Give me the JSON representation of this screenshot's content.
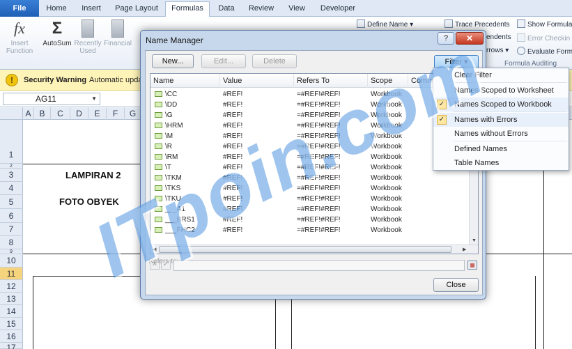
{
  "tabs": [
    "File",
    "Home",
    "Insert",
    "Page Layout",
    "Formulas",
    "Data",
    "Review",
    "View",
    "Developer"
  ],
  "ribbon": {
    "insert_function": "Insert Function",
    "autosum": "AutoSum",
    "recently_used": "Recently Used",
    "financial": "Financial",
    "define_name": "Define Name",
    "trace_precedents": "Trace Precedents",
    "trace_dependents": "endents",
    "remove_arrows": "rrows",
    "show_formulas": "Show Formula",
    "error_checking": "Error Checkin",
    "evaluate_formula": "Evaluate Form",
    "formula_auditing": "Formula Auditing"
  },
  "security": {
    "title": "Security Warning",
    "text": "Automatic upda"
  },
  "namebox": {
    "value": "AG11"
  },
  "columns": [
    "A",
    "B",
    "C",
    "D",
    "E",
    "F",
    "G"
  ],
  "rows": [
    "1",
    "2",
    "3",
    "4",
    "5",
    "6",
    "7",
    "8",
    "9",
    "10",
    "11",
    "12",
    "13",
    "14",
    "15",
    "16",
    "17"
  ],
  "sheet": {
    "lampiran": "LAMPIRAN 2",
    "foto": "FOTO OBYEK"
  },
  "dialog": {
    "title": "Name Manager",
    "help": "?",
    "close": "✕",
    "new_btn": "New...",
    "edit_btn": "Edit...",
    "delete_btn": "Delete",
    "filter_btn": "Filter ▾",
    "headers": [
      "Name",
      "Value",
      "Refers To",
      "Scope",
      "Comme"
    ],
    "rows": [
      [
        "\\CC",
        "#REF!",
        "=#REF!#REF!",
        "Workbook"
      ],
      [
        "\\DD",
        "#REF!",
        "=#REF!#REF!",
        "Workbook"
      ],
      [
        "\\G",
        "#REF!",
        "=#REF!#REF!",
        "Workbook"
      ],
      [
        "\\HRM",
        "#REF!",
        "=#REF!#REF!",
        "Workbook"
      ],
      [
        "\\M",
        "#REF!",
        "=#REF!#REF!",
        "Workbook"
      ],
      [
        "\\R",
        "#REF!",
        "=#REF!#REF!",
        "Workbook"
      ],
      [
        "\\RM",
        "#REF!",
        "=#REF!#REF!",
        "Workbook"
      ],
      [
        "\\T",
        "#REF!",
        "=#REF!#REF!",
        "Workbook"
      ],
      [
        "\\TKM",
        "#REF!",
        "=#REF!#REF!",
        "Workbook"
      ],
      [
        "\\TKS",
        "#REF!",
        "=#REF!#REF!",
        "Workbook"
      ],
      [
        "\\TKU",
        "#REF!",
        "=#REF!#REF!",
        "Workbook"
      ],
      [
        "___A1",
        "#REF!",
        "=#REF!#REF!",
        "Workbook"
      ],
      [
        "___BRS1",
        "#REF!",
        "=#REF!#REF!",
        "Workbook"
      ],
      [
        "___FHC2",
        "#REF!",
        "=#REF!#REF!",
        "Workbook"
      ]
    ],
    "refers_label": "Refers to:",
    "close_btn": "Close"
  },
  "filter_menu": {
    "items": [
      {
        "label": "Clear Filter",
        "checked": false
      },
      {
        "label": "Names Scoped to Worksheet",
        "checked": false
      },
      {
        "label": "Names Scoped to Workbook",
        "checked": true
      },
      {
        "label": "Names with Errors",
        "checked": true
      },
      {
        "label": "Names without Errors",
        "checked": false
      },
      {
        "label": "Defined Names",
        "checked": false
      },
      {
        "label": "Table Names",
        "checked": false
      }
    ]
  },
  "watermark": "ITpoin.com"
}
